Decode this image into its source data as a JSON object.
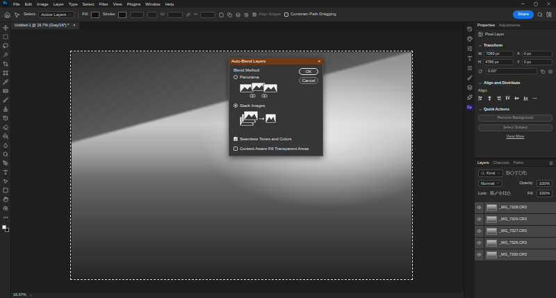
{
  "app": {
    "logo": "Ps"
  },
  "menu": [
    "File",
    "Edit",
    "Image",
    "Layer",
    "Type",
    "Select",
    "Filter",
    "View",
    "Plugins",
    "Window",
    "Help"
  ],
  "options_bar": {
    "select_label": "Select:",
    "select_value": "Active Layers",
    "fill_label": "Fill:",
    "stroke_label": "Stroke:",
    "w_label": "W:",
    "h_label": "H:",
    "align_edges": {
      "label": "Align Edges",
      "checked": true,
      "disabled": true
    },
    "constrain": {
      "label": "Constrain Path Dragging",
      "checked": false,
      "disabled": false
    },
    "share": "Share"
  },
  "document_tab": {
    "title": "Untitled-1 @ 16.7% (Gray/16*) *",
    "close": "×"
  },
  "dialog": {
    "title": "Auto-Blend Layers",
    "close": "×",
    "group": "Blend Method",
    "methods": [
      {
        "label": "Panorama",
        "selected": false
      },
      {
        "label": "Stack Images",
        "selected": true
      }
    ],
    "options": [
      {
        "label": "Seamless Tones and Colors",
        "checked": true
      },
      {
        "label": "Content Aware Fill Transparent Areas",
        "checked": false
      }
    ],
    "buttons": [
      {
        "label": "OK",
        "default": true
      },
      {
        "label": "Cancel",
        "default": false
      }
    ]
  },
  "icon_strip": {
    "plugin_badge": "Ep"
  },
  "properties": {
    "tabs": [
      {
        "label": "Properties",
        "selected": true
      },
      {
        "label": "Adjustments",
        "selected": false
      }
    ],
    "layer_kind": "Pixel Layer",
    "transform": {
      "title": "Transform",
      "fields": [
        {
          "label": "W",
          "value": "7089 px"
        },
        {
          "label": "X",
          "value": "0 px"
        },
        {
          "label": "H",
          "value": "4786 px"
        },
        {
          "label": "Y",
          "value": "0 px"
        }
      ],
      "angle": "0.00°"
    },
    "align": {
      "title": "Align and Distribute",
      "label": "Align:"
    },
    "quick_actions": {
      "title": "Quick Actions",
      "buttons": [
        "Remove Background",
        "Select Subject"
      ],
      "link": "View More"
    }
  },
  "layers": {
    "tabs": [
      {
        "label": "Layers",
        "selected": true
      },
      {
        "label": "Channels",
        "selected": false
      },
      {
        "label": "Paths",
        "selected": false
      }
    ],
    "filter": "Kind",
    "blend_mode": "Normal",
    "opacity_label": "Opacity:",
    "opacity": "100%",
    "lock_label": "Lock:",
    "fill_label": "Fill:",
    "fill": "100%",
    "items": [
      {
        "name": "_MG_7328.CR3",
        "visible": true,
        "selected": true
      },
      {
        "name": "_MG_7329.CR3",
        "visible": true,
        "selected": true
      },
      {
        "name": "_MG_7327.CR3",
        "visible": true,
        "selected": true
      },
      {
        "name": "_MG_7326.CR3",
        "visible": true,
        "selected": true
      },
      {
        "name": "_MG_7330.CR3",
        "visible": true,
        "selected": true
      }
    ]
  },
  "status_bar": {
    "zoom": "16.67%"
  }
}
